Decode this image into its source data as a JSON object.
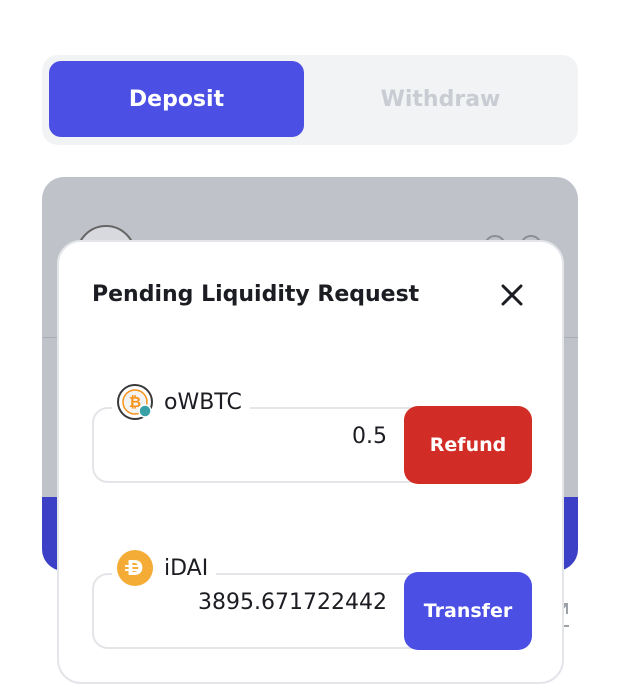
{
  "tabs": {
    "deposit_label": "Deposit",
    "withdraw_label": "Withdraw"
  },
  "modal": {
    "title": "Pending Liquidity Request",
    "close_icon": "close-icon",
    "tokens": [
      {
        "symbol": "oWBTC",
        "icon": "bitcoin-icon",
        "amount": "0.5",
        "action_label": "Refund",
        "action_color": "#d12d26"
      },
      {
        "symbol": "iDAI",
        "icon": "dai-icon",
        "amount": "3895.671722442",
        "action_label": "Transfer",
        "action_color": "#4b4fe4"
      }
    ]
  },
  "colors": {
    "accent": "#4b4fe4",
    "danger": "#d12d26",
    "overlay_card": "#bfc2c9"
  }
}
